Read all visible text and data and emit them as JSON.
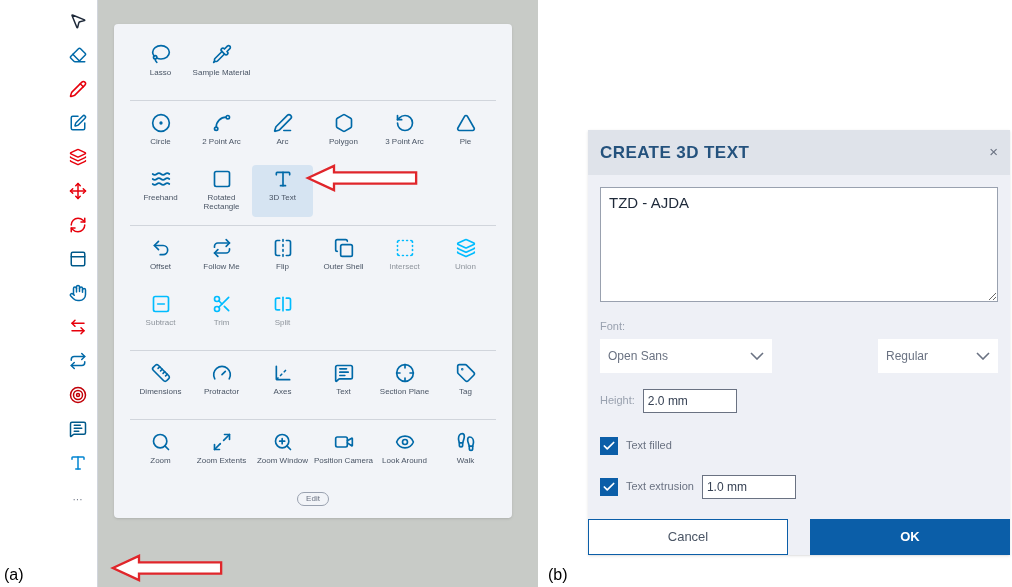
{
  "panel_a": {
    "caption": "(a)",
    "toolbar": {
      "more": "···"
    },
    "tool_panel": {
      "sections": [
        {
          "tools": [
            {
              "label": "Lasso",
              "selected": false,
              "disabled": false
            },
            {
              "label": "Sample Material",
              "selected": false,
              "disabled": false
            }
          ]
        },
        {
          "tools": [
            {
              "label": "Circle",
              "selected": false,
              "disabled": false
            },
            {
              "label": "2 Point Arc",
              "selected": false,
              "disabled": false
            },
            {
              "label": "Arc",
              "selected": false,
              "disabled": false
            },
            {
              "label": "Polygon",
              "selected": false,
              "disabled": false
            },
            {
              "label": "3 Point Arc",
              "selected": false,
              "disabled": false
            },
            {
              "label": "Pie",
              "selected": false,
              "disabled": false
            },
            {
              "label": "Freehand",
              "selected": false,
              "disabled": false
            },
            {
              "label": "Rotated Rectangle",
              "selected": false,
              "disabled": false
            },
            {
              "label": "3D Text",
              "selected": true,
              "disabled": false
            }
          ]
        },
        {
          "tools": [
            {
              "label": "Offset",
              "selected": false,
              "disabled": false
            },
            {
              "label": "Follow Me",
              "selected": false,
              "disabled": false
            },
            {
              "label": "Flip",
              "selected": false,
              "disabled": false
            },
            {
              "label": "Outer Shell",
              "selected": false,
              "disabled": false
            },
            {
              "label": "Intersect",
              "selected": false,
              "disabled": true
            },
            {
              "label": "Union",
              "selected": false,
              "disabled": true
            },
            {
              "label": "Subtract",
              "selected": false,
              "disabled": true
            },
            {
              "label": "Trim",
              "selected": false,
              "disabled": true
            },
            {
              "label": "Split",
              "selected": false,
              "disabled": true
            }
          ]
        },
        {
          "tools": [
            {
              "label": "Dimensions",
              "selected": false,
              "disabled": false
            },
            {
              "label": "Protractor",
              "selected": false,
              "disabled": false
            },
            {
              "label": "Axes",
              "selected": false,
              "disabled": false
            },
            {
              "label": "Text",
              "selected": false,
              "disabled": false
            },
            {
              "label": "Section Plane",
              "selected": false,
              "disabled": false
            },
            {
              "label": "Tag",
              "selected": false,
              "disabled": false
            }
          ]
        },
        {
          "tools": [
            {
              "label": "Zoom",
              "selected": false,
              "disabled": false
            },
            {
              "label": "Zoom Extents",
              "selected": false,
              "disabled": false
            },
            {
              "label": "Zoom Window",
              "selected": false,
              "disabled": false
            },
            {
              "label": "Position Camera",
              "selected": false,
              "disabled": false
            },
            {
              "label": "Look Around",
              "selected": false,
              "disabled": false
            },
            {
              "label": "Walk",
              "selected": false,
              "disabled": false
            }
          ]
        }
      ],
      "edit_button": "Edit"
    }
  },
  "panel_b": {
    "caption": "(b)",
    "dialog": {
      "title": "CREATE 3D TEXT",
      "close": "×",
      "text": "TZD - AJDA",
      "font_label": "Font:",
      "font": "Open Sans",
      "style": "Regular",
      "height_label": "Height:",
      "height": "2.0 mm",
      "options": [
        {
          "label": "Text filled",
          "checked": true
        },
        {
          "label": "Text extrusion",
          "checked": true,
          "value": "1.0 mm"
        }
      ],
      "cancel": "Cancel",
      "ok": "OK"
    }
  }
}
